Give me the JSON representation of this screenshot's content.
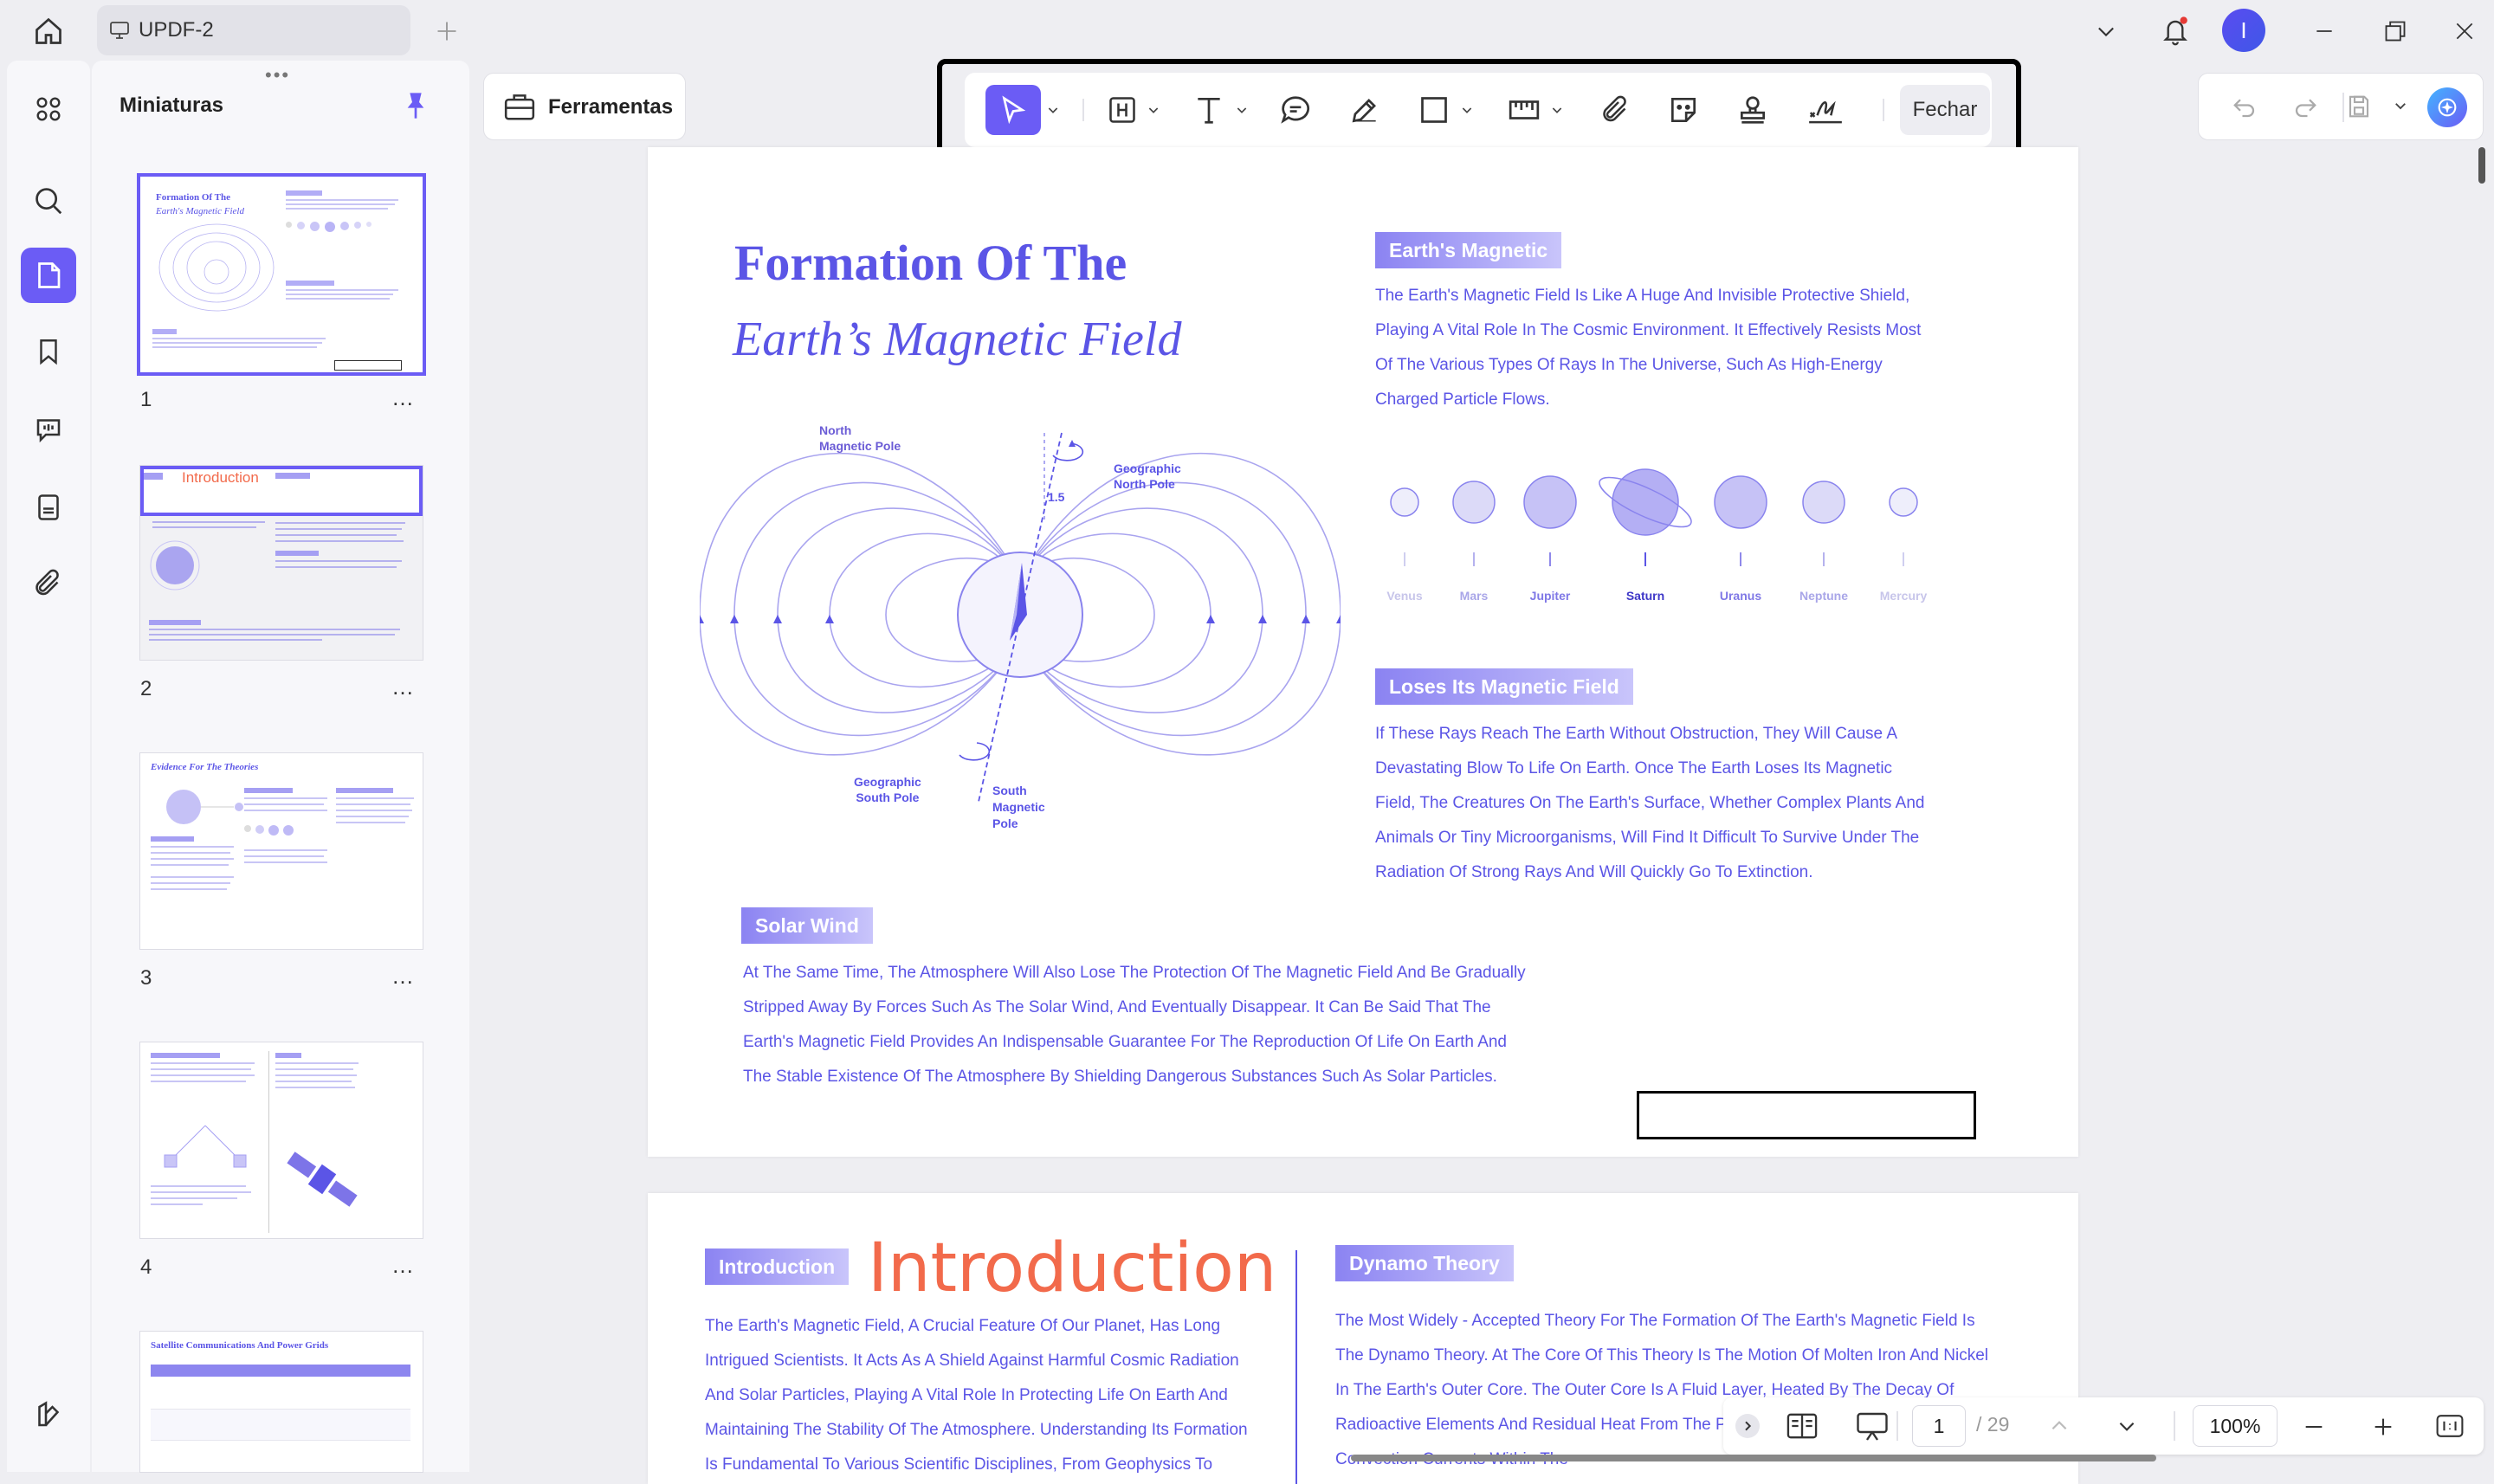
{
  "titlebar": {
    "tab_title": "UPDF-2",
    "avatar_letter": "I"
  },
  "thumbnails": {
    "title": "Miniaturas",
    "pages": [
      {
        "number": "1",
        "heading1": "Formation Of The",
        "heading2": "Earth's Magnetic Field"
      },
      {
        "number": "2",
        "heading1": "Introduction"
      },
      {
        "number": "3",
        "heading1": "Evidence For The Theories"
      },
      {
        "number": "4"
      },
      {
        "number": "",
        "heading1": "Satellite Communications And Power Grids"
      }
    ],
    "more": "…"
  },
  "tools_panel": {
    "label": "Ferramentas"
  },
  "toolbar": {
    "close_label": "Fechar"
  },
  "page1": {
    "title_line1": "Formation Of The",
    "title_line2": "Earth’s Magnetic Field",
    "diagram": {
      "north_magnetic": [
        "North",
        "Magnetic Pole"
      ],
      "geo_north": [
        "Geographic",
        "North Pole"
      ],
      "angle": "1.5",
      "geo_south": [
        "Geographic",
        "South Pole"
      ],
      "south_magnetic": [
        "South",
        "Magnetic",
        "Pole"
      ]
    },
    "earths_magnetic": {
      "tag": "Earth's Magnetic",
      "lines": [
        "The Earth's Magnetic Field Is Like A Huge And Invisible Protective Shield,",
        "Playing A Vital Role In The Cosmic Environment. It Effectively Resists Most",
        "Of The Various Types Of Rays In The Universe, Such As High-Energy",
        "Charged Particle Flows."
      ]
    },
    "planets": [
      "Venus",
      "Mars",
      "Jupiter",
      "Saturn",
      "Uranus",
      "Neptune",
      "Mercury"
    ],
    "loses": {
      "tag": "Loses Its Magnetic Field",
      "lines": [
        "If These Rays Reach The Earth Without Obstruction, They Will Cause A",
        "Devastating Blow To Life On Earth. Once The Earth Loses Its Magnetic",
        "Field, The Creatures On The Earth's Surface, Whether Complex Plants And",
        "Animals Or Tiny Microorganisms, Will Find It Difficult To Survive Under The",
        "Radiation Of Strong Rays And Will Quickly Go To Extinction."
      ]
    },
    "solar_wind": {
      "tag": "Solar Wind",
      "lines": [
        "At The Same Time, The Atmosphere Will Also Lose The Protection Of The Magnetic Field And Be Gradually",
        "Stripped Away By Forces Such As The Solar Wind, And Eventually Disappear. It Can Be Said That The",
        "Earth's Magnetic Field Provides An Indispensable Guarantee For The Reproduction Of Life On Earth And",
        "The Stable Existence Of The Atmosphere By Shielding Dangerous Substances Such As Solar Particles."
      ]
    }
  },
  "page2": {
    "intro_tag": "Introduction",
    "intro_title": "Introduction",
    "intro_lines": [
      "The Earth's Magnetic Field, A Crucial Feature Of Our Planet, Has Long",
      "Intrigued Scientists. It Acts As A Shield Against Harmful Cosmic Radiation",
      "And Solar Particles, Playing A Vital Role In Protecting Life On Earth And",
      "Maintaining The Stability Of The Atmosphere. Understanding Its Formation",
      "Is Fundamental To Various Scientific Disciplines, From Geophysics To"
    ],
    "dynamo_tag": "Dynamo Theory",
    "dynamo_lines": [
      "The Most Widely - Accepted Theory For The Formation Of The Earth's Magnetic Field Is",
      "The Dynamo Theory. At The Core Of This Theory Is The Motion Of Molten Iron And Nickel",
      "In The Earth's Outer Core. The Outer Core Is A Fluid Layer, Heated By The Decay Of",
      "Radioactive Elements And Residual Heat From The Planet's Formation.",
      "Convection Currents Within The"
    ]
  },
  "bottombar": {
    "current_page": "1",
    "total_pages": "/ 29",
    "zoom": "100%"
  },
  "colors": {
    "accent": "#6b5cf5",
    "doc_text": "#5b55e6",
    "intro_red": "#f26a4b"
  }
}
